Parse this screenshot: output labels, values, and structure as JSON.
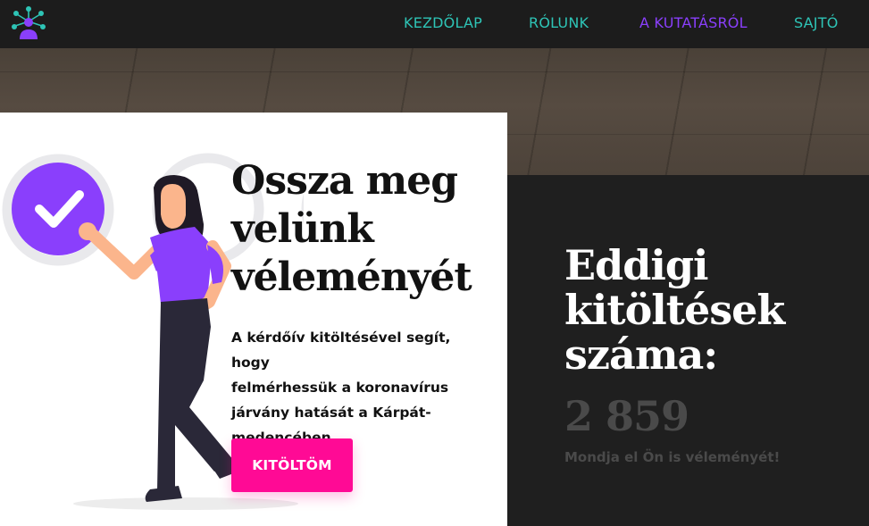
{
  "colors": {
    "accent_teal": "#2ec4b6",
    "accent_purple": "#8a3ffc",
    "cta_pink": "#ff0a95",
    "dark_bg": "#1f1f1f"
  },
  "nav": {
    "logo_icon": "network-people-icon",
    "items": [
      {
        "label": "KEZDŐLAP",
        "active": false
      },
      {
        "label": "RÓLUNK",
        "active": false
      },
      {
        "label": "A KUTATÁSRÓL",
        "active": true
      },
      {
        "label": "SAJTÓ",
        "active": false
      }
    ]
  },
  "hero": {
    "headline_lines": [
      "Ossza meg",
      "velünk",
      "véleményét"
    ],
    "description_lines": [
      "A kérdőív kitöltésével segít, hogy",
      "felmérhessük a koronavírus",
      "járvány hatását a Kárpát-",
      "medencében."
    ],
    "cta_label": "KITÖLTÖM",
    "illustration_icon": "woman-checkmark-illustration"
  },
  "counter": {
    "title_lines": [
      "Eddigi",
      "kitöltések",
      "száma:"
    ],
    "value": "2 859",
    "subtitle": "Mondja el Ön is véleményét!"
  }
}
